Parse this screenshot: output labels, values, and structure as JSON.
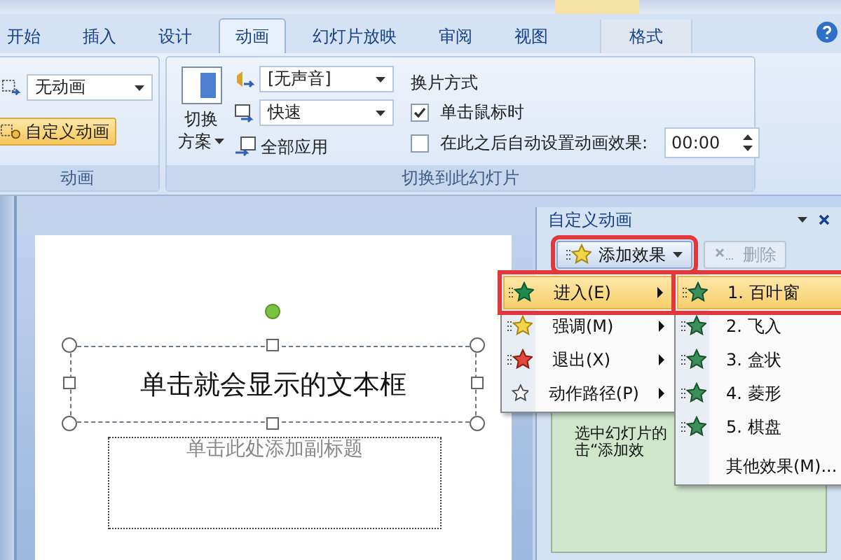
{
  "tabs": [
    {
      "label": "开始",
      "selected": false,
      "contextual": false
    },
    {
      "label": "插入",
      "selected": false,
      "contextual": false
    },
    {
      "label": "设计",
      "selected": false,
      "contextual": false
    },
    {
      "label": "动画",
      "selected": true,
      "contextual": false
    },
    {
      "label": "幻灯片放映",
      "selected": false,
      "contextual": false
    },
    {
      "label": "审阅",
      "selected": false,
      "contextual": false
    },
    {
      "label": "视图",
      "selected": false,
      "contextual": false
    },
    {
      "label": "格式",
      "selected": false,
      "contextual": true
    }
  ],
  "ribbon": {
    "animation_group": {
      "label": "动画",
      "effect_dropdown": {
        "value": "无动画"
      },
      "custom_button": {
        "label": "自定义动画",
        "selected": true
      }
    },
    "transition_group": {
      "label": "切换到此幻灯片",
      "scheme_button": {
        "label_lines": [
          "切换",
          "方案"
        ]
      },
      "sound_dropdown": {
        "value": "[无声音]"
      },
      "speed_dropdown": {
        "value": "快速"
      },
      "apply_all_button": {
        "label": "全部应用"
      },
      "advance": {
        "heading": "换片方式",
        "options": [
          {
            "label": "单击鼠标时",
            "checked": true
          },
          {
            "label": "在此之后自动设置动画效果:",
            "checked": false
          }
        ],
        "time_field": {
          "value": "00:00"
        }
      }
    }
  },
  "slide": {
    "title_box": {
      "text": "单击就会显示的文本框",
      "selected": true
    },
    "subtitle_placeholder": "单击此处添加副标题"
  },
  "task_pane": {
    "title": "自定义动画",
    "add_button": {
      "label": "添加效果",
      "marked": true
    },
    "remove_button": {
      "label": "删除",
      "disabled": true
    },
    "hint_lines": [
      "选中幻灯片的",
      "击“添加效"
    ]
  },
  "effect_menu": {
    "items": [
      {
        "label": "进入(E)",
        "kind": "entrance",
        "selected": true,
        "marked": true
      },
      {
        "label": "强调(M)",
        "kind": "emphasis",
        "selected": false,
        "marked": false
      },
      {
        "label": "退出(X)",
        "kind": "exit",
        "selected": false,
        "marked": false
      },
      {
        "label": "动作路径(P)",
        "kind": "path",
        "selected": false,
        "marked": false
      }
    ]
  },
  "submenu": {
    "items": [
      {
        "label": "1. 百叶窗",
        "kind": "effect",
        "selected": true,
        "marked": true
      },
      {
        "label": "2. 飞入",
        "kind": "fly",
        "selected": false,
        "marked": false
      },
      {
        "label": "3. 盒状",
        "kind": "effect",
        "selected": false,
        "marked": false
      },
      {
        "label": "4. 菱形",
        "kind": "effect",
        "selected": false,
        "marked": false
      },
      {
        "label": "5. 棋盘",
        "kind": "effect",
        "selected": false,
        "marked": false
      },
      {
        "label": "其他效果(M)...",
        "kind": "more",
        "selected": false,
        "marked": false
      }
    ]
  }
}
